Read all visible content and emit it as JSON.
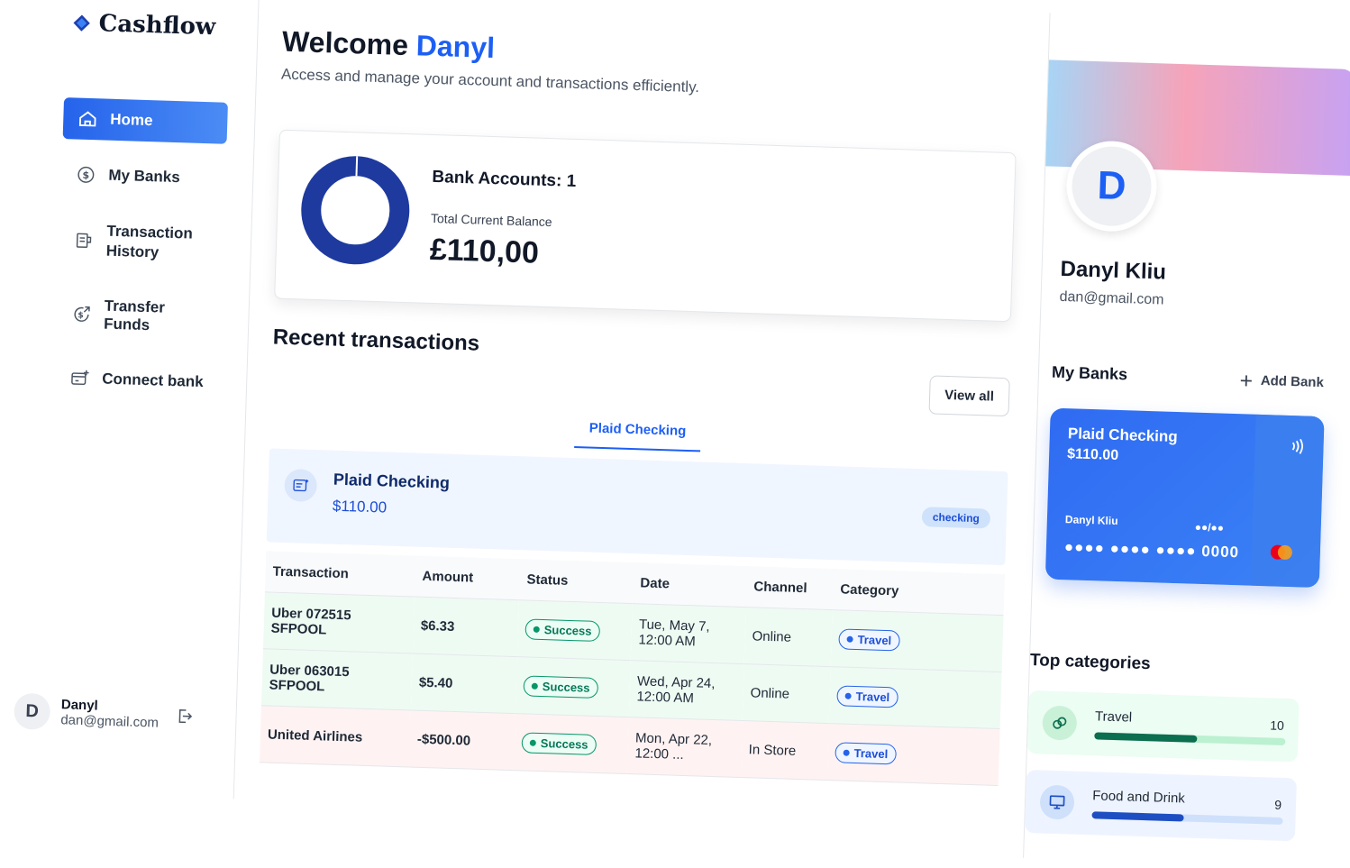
{
  "app": {
    "name": "Cashflow"
  },
  "sidebar": {
    "items": [
      {
        "label": "Home",
        "icon": "home-icon",
        "active": true
      },
      {
        "label": "My Banks",
        "icon": "dollar-icon"
      },
      {
        "label": "Transaction History",
        "icon": "receipt-icon"
      },
      {
        "label": "Transfer Funds",
        "icon": "transfer-icon"
      },
      {
        "label": "Connect bank",
        "icon": "connect-bank-icon"
      }
    ],
    "user": {
      "initial": "D",
      "name": "Danyl",
      "email": "dan@gmail.com"
    }
  },
  "header": {
    "welcome": "Welcome",
    "name": "Danyl",
    "subtitle": "Access and manage your account and transactions efficiently."
  },
  "balance": {
    "accounts_label": "Bank Accounts: 1",
    "total_label": "Total Current Balance",
    "total_value": "£110,00",
    "accounts_count": 1
  },
  "recent": {
    "title": "Recent transactions",
    "view_all": "View all",
    "tabs": [
      "Plaid Checking"
    ],
    "account": {
      "name": "Plaid Checking",
      "balance": "$110.00",
      "badge": "checking"
    },
    "columns": [
      "Transaction",
      "Amount",
      "Status",
      "Date",
      "Channel",
      "Category"
    ],
    "rows": [
      {
        "name": "Uber 072515 SFPOOL",
        "amount": "$6.33",
        "status": "Success",
        "date": "Tue, May 7, 12:00 AM",
        "channel": "Online",
        "category": "Travel",
        "type": "pos"
      },
      {
        "name": "Uber 063015 SFPOOL",
        "amount": "$5.40",
        "status": "Success",
        "date": "Wed, Apr 24, 12:00 AM",
        "channel": "Online",
        "category": "Travel",
        "type": "pos"
      },
      {
        "name": "United Airlines",
        "amount": "-$500.00",
        "status": "Success",
        "date": "Mon, Apr 22, 12:00 ...",
        "channel": "In Store",
        "category": "Travel",
        "type": "neg"
      }
    ]
  },
  "profile": {
    "initial": "D",
    "name": "Danyl Kliu",
    "email": "dan@gmail.com"
  },
  "my_banks": {
    "title": "My Banks",
    "add_label": "Add Bank",
    "card": {
      "name": "Plaid Checking",
      "balance": "$110.00",
      "holder": "Danyl Kliu",
      "expiry": "●●/●●",
      "number": "●●●● ●●●● ●●●● 0000"
    }
  },
  "top_categories": {
    "title": "Top categories",
    "items": [
      {
        "name": "Travel",
        "count": "10",
        "progress": 0.54
      },
      {
        "name": "Food and Drink",
        "count": "9",
        "progress": 0.48
      }
    ]
  },
  "colors": {
    "accent": "#1d5ff5",
    "success": "#059669",
    "danger": "#dc2626",
    "donut": "#1e3a9e"
  }
}
